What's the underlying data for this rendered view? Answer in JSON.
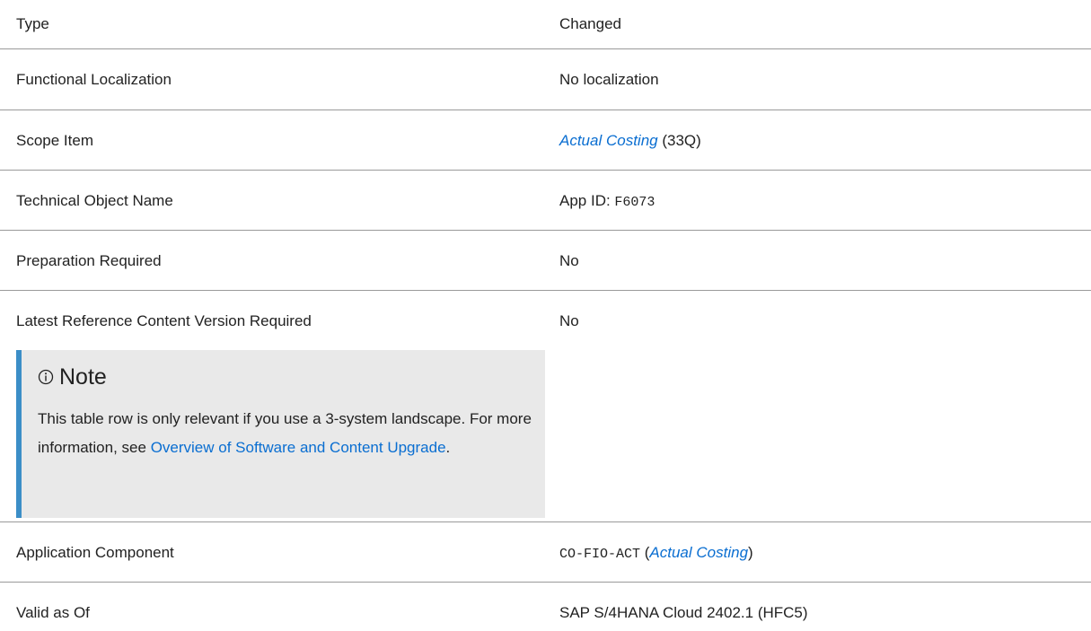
{
  "rows": [
    {
      "label": "Type",
      "value": "Changed"
    },
    {
      "label": "Functional Localization",
      "value": "No localization"
    },
    {
      "label": "Scope Item",
      "value_link": "Actual Costing",
      "value_suffix": " (33Q)"
    },
    {
      "label": "Technical Object Name",
      "value_prefix": "App ID: ",
      "value_code": "F6073"
    },
    {
      "label": "Preparation Required",
      "value": "No"
    },
    {
      "label": "Latest Reference Content Version Required",
      "value": "No"
    },
    {
      "label": "Application Component",
      "value_code": "CO-FIO-ACT",
      "value_open": " (",
      "value_link": "Actual Costing",
      "value_close": ")"
    },
    {
      "label": "Valid as Of",
      "value": "SAP S/4HANA Cloud 2402.1 (HFC5)"
    }
  ],
  "note": {
    "icon": "info-icon",
    "title": "Note",
    "text_before": "This table row is only relevant if you use a 3-system landscape. For more information, see ",
    "link_text": "Overview of Software and Content Upgrade",
    "text_after": "."
  },
  "colors": {
    "link": "#0a6ed1",
    "note_background": "#e9e9e9",
    "note_border": "#3b8ec7",
    "divider": "#9a9a9a"
  }
}
